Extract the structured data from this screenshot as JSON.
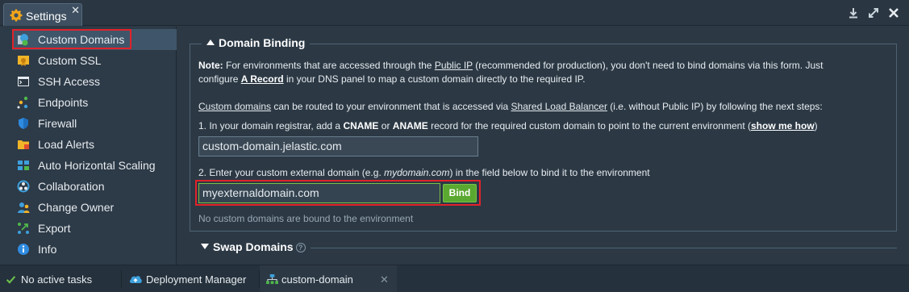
{
  "window": {
    "tab_title": "Settings",
    "tab_close": "✕",
    "controls": [
      "download-icon",
      "expand-icon",
      "close-icon"
    ]
  },
  "sidebar": {
    "items": [
      {
        "label": "Custom Domains",
        "icon": "globe-icon",
        "active": true
      },
      {
        "label": "Custom SSL",
        "icon": "certificate-icon"
      },
      {
        "label": "SSH Access",
        "icon": "terminal-icon"
      },
      {
        "label": "Endpoints",
        "icon": "endpoints-icon"
      },
      {
        "label": "Firewall",
        "icon": "shield-icon"
      },
      {
        "label": "Load Alerts",
        "icon": "folder-alert-icon"
      },
      {
        "label": "Auto Horizontal Scaling",
        "icon": "scaling-icon"
      },
      {
        "label": "Collaboration",
        "icon": "collaboration-icon"
      },
      {
        "label": "Change Owner",
        "icon": "owner-icon"
      },
      {
        "label": "Export",
        "icon": "export-icon"
      },
      {
        "label": "Info",
        "icon": "info-icon"
      }
    ]
  },
  "binding": {
    "legend": "Domain Binding",
    "note_label": "Note:",
    "note_1a": " For environments that are accessed through the ",
    "note_public_ip": "Public IP",
    "note_1b": " (recommended for production), you don't need to bind domains via this form. Just",
    "note_2a": "configure ",
    "note_a_record": "A Record",
    "note_2b": " in your DNS panel to map a custom domain directly to the required IP.",
    "custom_domains_link": "Custom domains",
    "routing_a": " can be routed to your environment that is accessed via ",
    "slb_link": "Shared Load Balancer",
    "routing_b": " (i.e. without Public IP) by following the next steps:",
    "step1_a": "1. In your domain registrar, add a ",
    "step1_cname": "CNAME",
    "step1_or": " or ",
    "step1_aname": "ANAME",
    "step1_b": " record for the required custom domain to point to the current environment (",
    "step1_show": "show me how",
    "step1_c": ")",
    "cname_value": "custom-domain.jelastic.com",
    "step2_a": "2. Enter your custom external domain (e.g. ",
    "step2_example": "mydomain.com",
    "step2_b": ") in the field below to bind it to the environment",
    "domain_value": "myexternaldomain.com",
    "bind_label": "Bind",
    "empty_msg": "No custom domains are bound to the environment"
  },
  "swap": {
    "legend": "Swap Domains",
    "help": "?"
  },
  "statusbar": {
    "tasks": "No active tasks",
    "deployment_manager": "Deployment Manager",
    "env_name": "custom-domain",
    "env_close": "✕"
  },
  "colors": {
    "accent_green": "#5aa830",
    "highlight_red": "#e2222a",
    "bg": "#2c3945"
  }
}
